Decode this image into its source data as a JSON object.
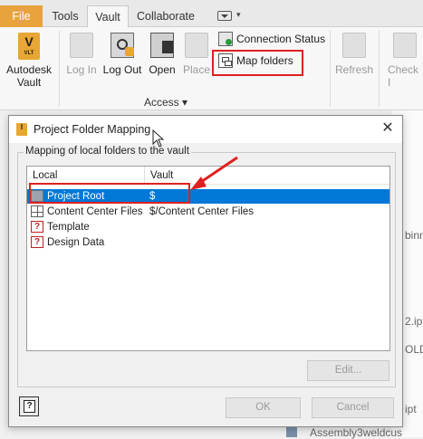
{
  "tabs": [
    {
      "label": "File"
    },
    {
      "label": "Tools"
    },
    {
      "label": "Vault"
    },
    {
      "label": "Collaborate"
    }
  ],
  "ribbon": {
    "autodesk_vault": "Autodesk",
    "autodesk_vault2": "Vault",
    "vlt_text": "V",
    "vlt_sub": "VLT",
    "log_in": "Log In",
    "log_out": "Log Out",
    "open": "Open",
    "place": "Place",
    "connection_status": "Connection Status",
    "map_folders": "Map folders",
    "refresh": "Refresh",
    "check_in": "Check I",
    "group_access": "Access"
  },
  "background": {
    "text1": "binn",
    "text2": "2.ipt",
    "text3": "OLD",
    "text4": "ipt",
    "text5": "Assembly3weldcus"
  },
  "dialog": {
    "title": "Project Folder Mapping",
    "group_title": "Mapping of local folders to the vault",
    "columns": [
      "Local",
      "Vault"
    ],
    "rows": [
      {
        "local": "Project Root",
        "vault": "$",
        "icon": "folder-icon",
        "selected": true
      },
      {
        "local": "Content Center Files",
        "vault": "$/Content Center Files",
        "icon": "grid-icon",
        "selected": false
      },
      {
        "local": "Template",
        "vault": "",
        "icon": "question-icon",
        "selected": false
      },
      {
        "local": "Design Data",
        "vault": "",
        "icon": "question-icon",
        "selected": false
      }
    ],
    "edit_button": "Edit...",
    "ok_button": "OK",
    "cancel_button": "Cancel"
  },
  "colors": {
    "file_tab": "#e8a33d",
    "selection": "#0078d7",
    "highlight": "#e02020"
  }
}
